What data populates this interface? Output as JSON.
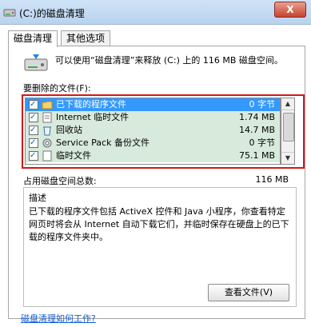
{
  "window": {
    "title": "(C:)的磁盘清理",
    "close_label": "X"
  },
  "tabs": [
    {
      "label": "磁盘清理"
    },
    {
      "label": "其他选项"
    }
  ],
  "info": {
    "text": "可以使用“磁盘清理”来释放 (C:) 上的 116 MB 磁盘空间。"
  },
  "files_label": "要删除的文件(F):",
  "files": [
    {
      "name": "已下载的程序文件",
      "size": "0 字节",
      "checked": true,
      "selected": true
    },
    {
      "name": "Internet 临时文件",
      "size": "1.74 MB",
      "checked": true,
      "selected": false
    },
    {
      "name": "回收站",
      "size": "14.7 MB",
      "checked": true,
      "selected": false
    },
    {
      "name": "Service Pack 备份文件",
      "size": "0 字节",
      "checked": true,
      "selected": false
    },
    {
      "name": "临时文件",
      "size": "75.1 MB",
      "checked": true,
      "selected": false
    }
  ],
  "summary": {
    "label": "占用磁盘空间总数:",
    "value": "116 MB"
  },
  "description": {
    "title": "描述",
    "text": "已下载的程序文件包括 ActiveX 控件和 Java 小程序，你查看特定网页时将会从 Internet 自动下载它们，并临时保存在硬盘上的已下载的程序文件夹中。",
    "button_label": "查看文件(V)"
  },
  "help_link": "磁盘清理如何工作?"
}
